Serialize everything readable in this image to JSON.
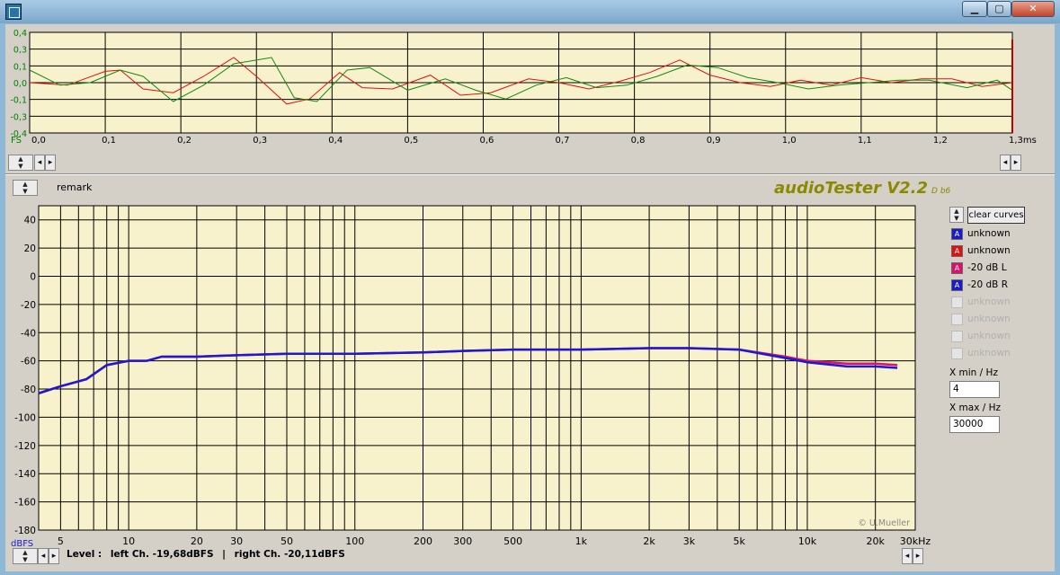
{
  "window": {
    "min_symbol": "▁",
    "max_symbol": "▢",
    "close_symbol": "✕"
  },
  "brand": {
    "name": "audioTester V2.2",
    "build": "D b6"
  },
  "remark": "remark",
  "wave_chart": {
    "type": "line",
    "xlim": [
      0,
      1.3
    ],
    "ylim": [
      -0.4,
      0.4
    ],
    "x_ticks": [
      "0,0",
      "0,1",
      "0,2",
      "0,3",
      "0,4",
      "0,5",
      "0,6",
      "0,7",
      "0,8",
      "0,9",
      "1,0",
      "1,1",
      "1,2",
      "1,3ms"
    ],
    "y_ticks": [
      "0,4",
      "0,3",
      "0,1",
      "0,0",
      "-0,1",
      "-0,3",
      "-0,4"
    ],
    "y_unit": "FS",
    "background": "#f8f2cc",
    "series": [
      {
        "color": "#e01010",
        "points": [
          [
            0,
            0
          ],
          [
            0.05,
            -0.02
          ],
          [
            0.1,
            0.09
          ],
          [
            0.12,
            0.1
          ],
          [
            0.15,
            -0.05
          ],
          [
            0.19,
            -0.08
          ],
          [
            0.23,
            0.05
          ],
          [
            0.27,
            0.2
          ],
          [
            0.3,
            0.05
          ],
          [
            0.34,
            -0.17
          ],
          [
            0.37,
            -0.13
          ],
          [
            0.41,
            0.08
          ],
          [
            0.44,
            -0.04
          ],
          [
            0.48,
            -0.05
          ],
          [
            0.53,
            0.06
          ],
          [
            0.57,
            -0.1
          ],
          [
            0.61,
            -0.08
          ],
          [
            0.66,
            0.03
          ],
          [
            0.7,
            0.0
          ],
          [
            0.74,
            -0.05
          ],
          [
            0.78,
            0.01
          ],
          [
            0.82,
            0.08
          ],
          [
            0.86,
            0.18
          ],
          [
            0.9,
            0.06
          ],
          [
            0.94,
            0.0
          ],
          [
            0.98,
            -0.03
          ],
          [
            1.02,
            0.02
          ],
          [
            1.06,
            -0.02
          ],
          [
            1.1,
            0.04
          ],
          [
            1.14,
            0.0
          ],
          [
            1.18,
            0.03
          ],
          [
            1.22,
            0.03
          ],
          [
            1.26,
            -0.03
          ],
          [
            1.3,
            0.0
          ]
        ]
      },
      {
        "color": "#108a10",
        "points": [
          [
            0,
            0.1
          ],
          [
            0.04,
            -0.02
          ],
          [
            0.08,
            0.0
          ],
          [
            0.12,
            0.1
          ],
          [
            0.15,
            0.05
          ],
          [
            0.19,
            -0.15
          ],
          [
            0.23,
            -0.02
          ],
          [
            0.27,
            0.15
          ],
          [
            0.32,
            0.2
          ],
          [
            0.35,
            -0.12
          ],
          [
            0.38,
            -0.15
          ],
          [
            0.42,
            0.1
          ],
          [
            0.45,
            0.12
          ],
          [
            0.5,
            -0.06
          ],
          [
            0.55,
            0.03
          ],
          [
            0.59,
            -0.06
          ],
          [
            0.63,
            -0.13
          ],
          [
            0.67,
            -0.02
          ],
          [
            0.71,
            0.04
          ],
          [
            0.75,
            -0.04
          ],
          [
            0.79,
            -0.02
          ],
          [
            0.83,
            0.05
          ],
          [
            0.87,
            0.14
          ],
          [
            0.91,
            0.12
          ],
          [
            0.95,
            0.04
          ],
          [
            0.99,
            0.0
          ],
          [
            1.03,
            -0.05
          ],
          [
            1.07,
            -0.02
          ],
          [
            1.11,
            0.0
          ],
          [
            1.15,
            0.02
          ],
          [
            1.19,
            0.02
          ],
          [
            1.24,
            -0.04
          ],
          [
            1.28,
            0.02
          ],
          [
            1.3,
            -0.06
          ]
        ]
      }
    ]
  },
  "freq_chart": {
    "type": "line",
    "x_scale": "log",
    "xlim": [
      4,
      30000
    ],
    "ylim": [
      -180,
      50
    ],
    "x_ticks": [
      {
        "v": 5,
        "label": "5"
      },
      {
        "v": 10,
        "label": "10"
      },
      {
        "v": 20,
        "label": "20"
      },
      {
        "v": 30,
        "label": "30"
      },
      {
        "v": 50,
        "label": "50"
      },
      {
        "v": 100,
        "label": "100"
      },
      {
        "v": 200,
        "label": "200"
      },
      {
        "v": 300,
        "label": "300"
      },
      {
        "v": 500,
        "label": "500"
      },
      {
        "v": 1000,
        "label": "1k"
      },
      {
        "v": 2000,
        "label": "2k"
      },
      {
        "v": 3000,
        "label": "3k"
      },
      {
        "v": 5000,
        "label": "5k"
      },
      {
        "v": 10000,
        "label": "10k"
      },
      {
        "v": 20000,
        "label": "20k"
      },
      {
        "v": 30000,
        "label": "30kHz"
      }
    ],
    "y_ticks": [
      40,
      20,
      0,
      -20,
      -40,
      -60,
      -80,
      -100,
      -120,
      -140,
      -160,
      -180
    ],
    "y_unit": "dBFS",
    "credit": "© U.Mueller",
    "background": "#f8f2cc",
    "series": [
      {
        "name": "-20 dB L",
        "color": "#e0106a",
        "points": [
          [
            4,
            -83
          ],
          [
            5,
            -78
          ],
          [
            6.5,
            -73
          ],
          [
            8,
            -63
          ],
          [
            10,
            -60
          ],
          [
            12,
            -60
          ],
          [
            14,
            -57
          ],
          [
            20,
            -57
          ],
          [
            30,
            -56
          ],
          [
            50,
            -55
          ],
          [
            100,
            -55
          ],
          [
            200,
            -54
          ],
          [
            300,
            -53
          ],
          [
            500,
            -52
          ],
          [
            1000,
            -52
          ],
          [
            2000,
            -51
          ],
          [
            3000,
            -51
          ],
          [
            5000,
            -52
          ],
          [
            8000,
            -57
          ],
          [
            10000,
            -60
          ],
          [
            15000,
            -62
          ],
          [
            20000,
            -62
          ],
          [
            25000,
            -63
          ]
        ]
      },
      {
        "name": "-20 dB R",
        "color": "#1a1ad0",
        "points": [
          [
            4,
            -83
          ],
          [
            5,
            -78
          ],
          [
            6.5,
            -73
          ],
          [
            8,
            -63
          ],
          [
            10,
            -60
          ],
          [
            12,
            -60
          ],
          [
            14,
            -57
          ],
          [
            20,
            -57
          ],
          [
            30,
            -56
          ],
          [
            50,
            -55
          ],
          [
            100,
            -55
          ],
          [
            200,
            -54
          ],
          [
            300,
            -53
          ],
          [
            500,
            -52
          ],
          [
            1000,
            -52
          ],
          [
            2000,
            -51
          ],
          [
            3000,
            -51
          ],
          [
            5000,
            -52
          ],
          [
            8000,
            -58
          ],
          [
            10000,
            -61
          ],
          [
            15000,
            -64
          ],
          [
            20000,
            -64
          ],
          [
            25000,
            -65
          ]
        ]
      }
    ]
  },
  "controls": {
    "clear_curves": "clear curves",
    "xmin_label": "X min / Hz",
    "xmin_value": "4",
    "xmax_label": "X max / Hz",
    "xmax_value": "30000"
  },
  "legend": [
    {
      "label": "unknown",
      "color": "#1a1ad0",
      "enabled": true
    },
    {
      "label": "unknown",
      "color": "#e01010",
      "enabled": true
    },
    {
      "label": "-20 dB L",
      "color": "#e0106a",
      "enabled": true
    },
    {
      "label": "-20 dB R",
      "color": "#1a1ad0",
      "enabled": true
    },
    {
      "label": "unknown",
      "color": "#e4e4e4",
      "enabled": false
    },
    {
      "label": "unknown",
      "color": "#e4e4e4",
      "enabled": false
    },
    {
      "label": "unknown",
      "color": "#e4e4e4",
      "enabled": false
    },
    {
      "label": "unknown",
      "color": "#e4e4e4",
      "enabled": false
    }
  ],
  "level": {
    "label": "Level :",
    "left": "left Ch. -19,68dBFS",
    "separator": "|",
    "right": "right Ch. -20,11dBFS"
  }
}
